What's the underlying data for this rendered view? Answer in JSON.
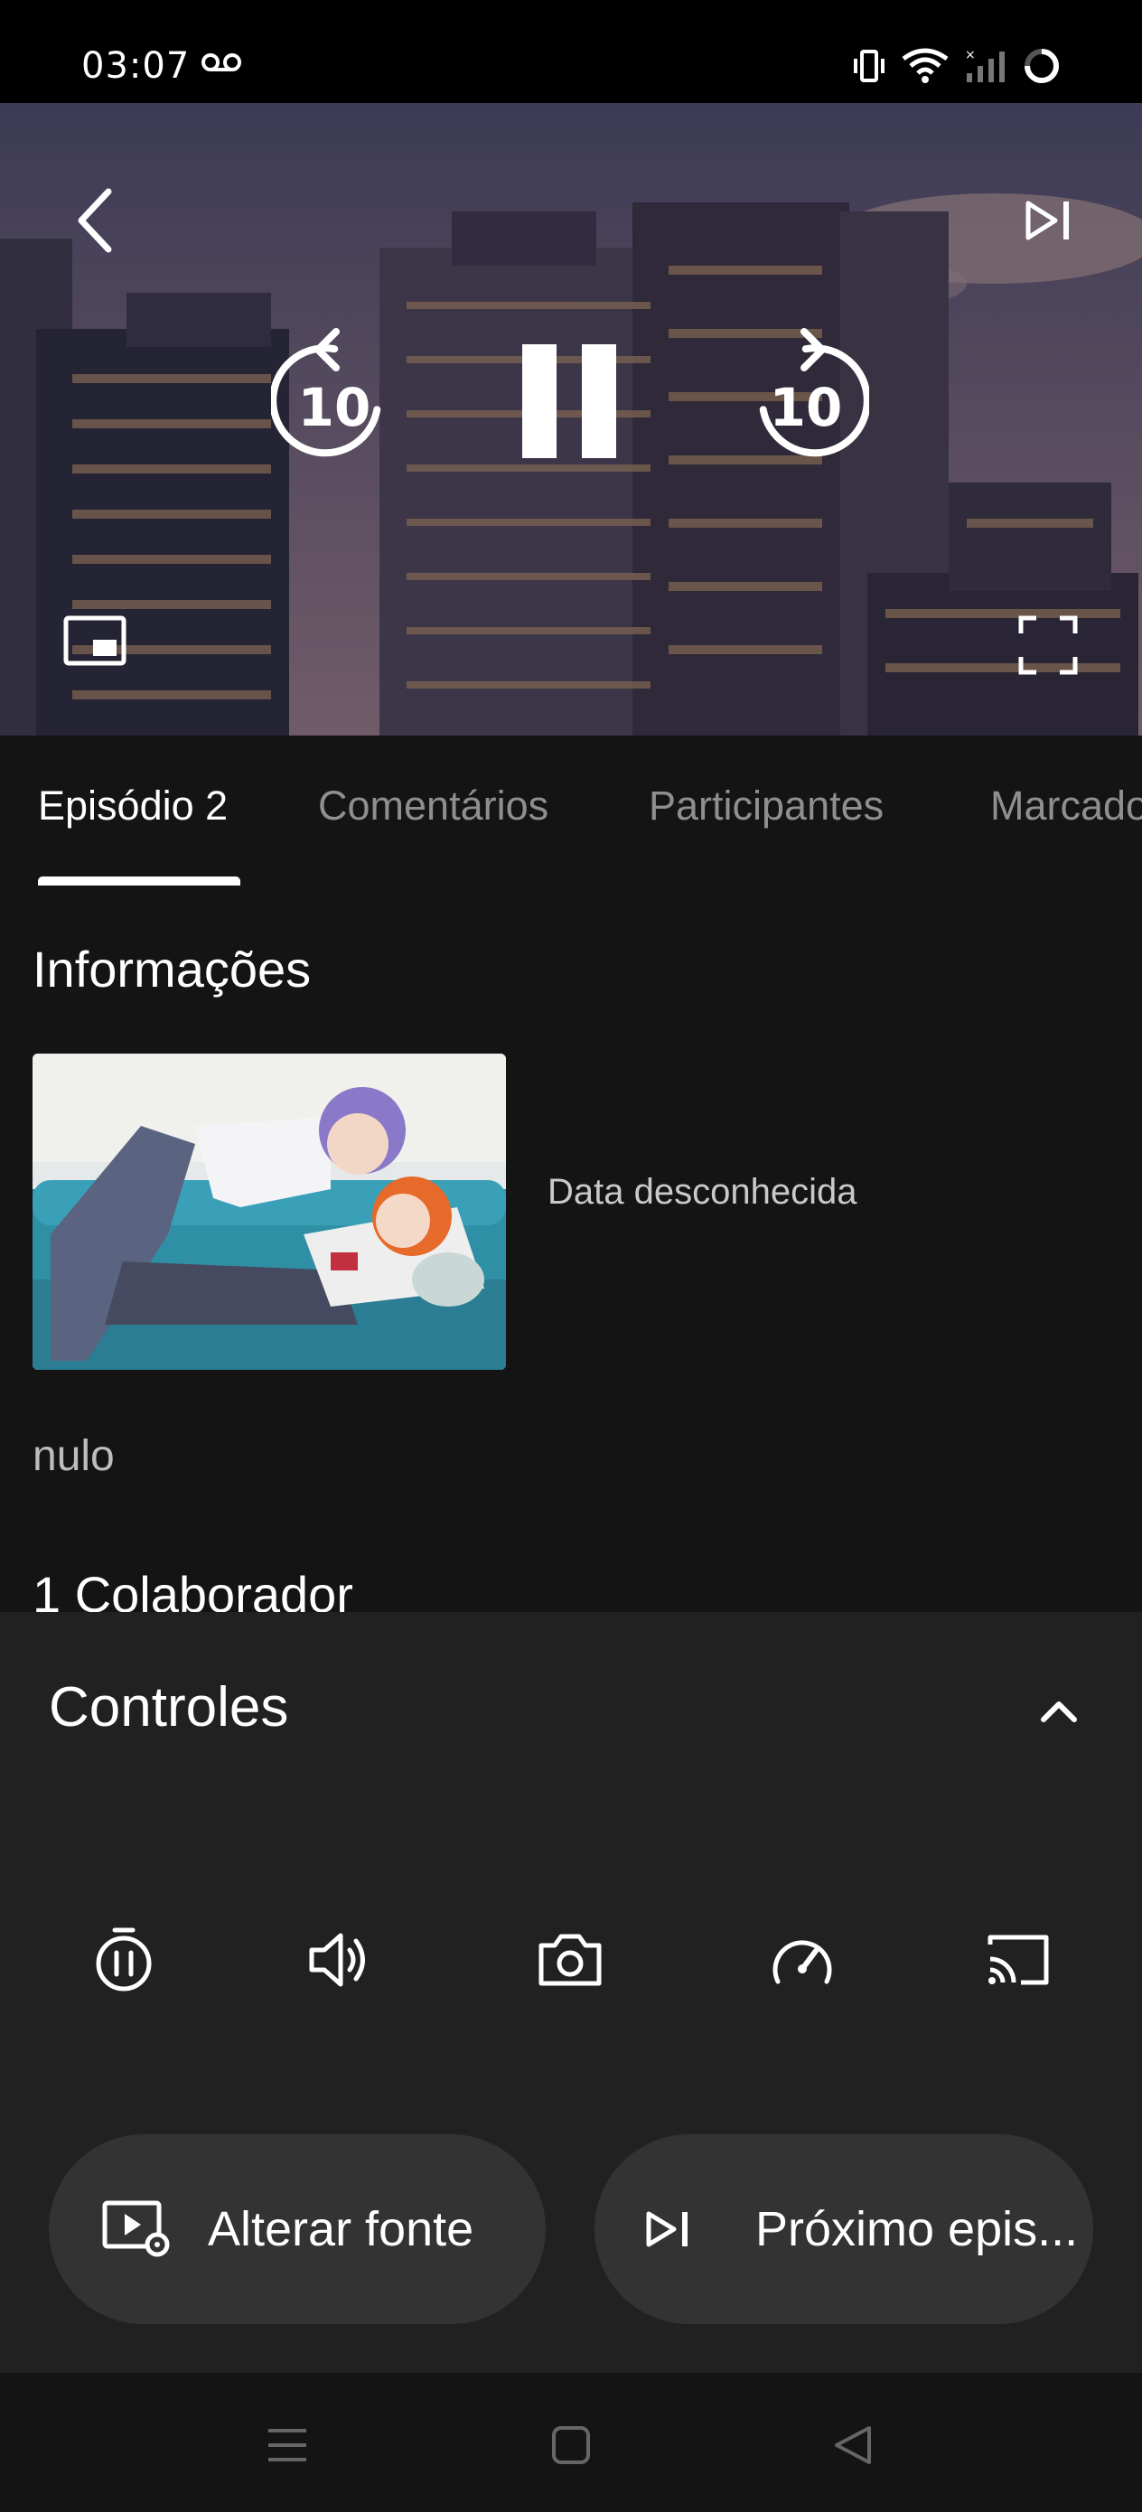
{
  "status_bar": {
    "time": "03:07",
    "icons": [
      "voicemail-icon",
      "vibrate-icon",
      "wifi-icon",
      "signal-icon",
      "battery-icon"
    ]
  },
  "player": {
    "rewind_label": "10",
    "forward_label": "10",
    "state": "playing"
  },
  "tabs": {
    "items": [
      {
        "label": "Episódio 2",
        "active": true
      },
      {
        "label": "Comentários",
        "active": false
      },
      {
        "label": "Participantes",
        "active": false
      },
      {
        "label": "Marcadores",
        "active": false
      }
    ]
  },
  "info": {
    "section_title": "Informações",
    "date": "Data desconhecida",
    "description": "nulo",
    "collaborators": "1 Colaborador"
  },
  "controls": {
    "title": "Controles",
    "tools": [
      "timer-icon",
      "volume-icon",
      "camera-icon",
      "speed-icon",
      "cast-icon"
    ],
    "change_source_label": "Alterar fonte",
    "next_episode_label": "Próximo epis..."
  },
  "colors": {
    "background": "#141414",
    "sheet": "#212121",
    "pill": "#333333",
    "inactive_tab": "#8f8f8f"
  }
}
